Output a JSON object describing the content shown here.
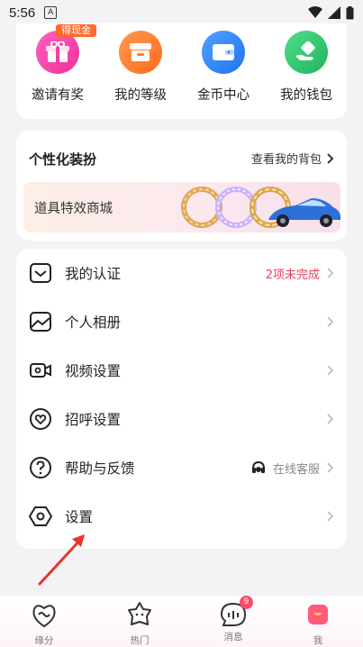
{
  "status_bar": {
    "time": "5:56",
    "notification_letter": "A"
  },
  "shortcuts": [
    {
      "label": "邀请有奖",
      "badge": "得现金",
      "icon": "gift-icon",
      "color": "#f23fa0"
    },
    {
      "label": "我的等级",
      "icon": "box-icon",
      "color": "#ff7a2b"
    },
    {
      "label": "金币中心",
      "icon": "wallet-icon",
      "color": "#2a84ff"
    },
    {
      "label": "我的钱包",
      "icon": "money-hand-icon",
      "color": "#2cc56b"
    }
  ],
  "personalization": {
    "title": "个性化装扮",
    "link": "查看我的背包",
    "banner_text": "道具特效商城"
  },
  "menu": [
    {
      "label": "我的认证",
      "right_text": "2项未完成",
      "icon": "shield-check-icon"
    },
    {
      "label": "个人相册",
      "right_text": "",
      "icon": "album-icon"
    },
    {
      "label": "视频设置",
      "right_text": "",
      "icon": "video-camera-icon"
    },
    {
      "label": "招呼设置",
      "right_text": "",
      "icon": "greeting-heart-icon"
    },
    {
      "label": "帮助与反馈",
      "right_text": "在线客服",
      "icon": "help-icon"
    },
    {
      "label": "设置",
      "right_text": "",
      "icon": "settings-hexagon-icon"
    }
  ],
  "bottom_nav": [
    {
      "label": "缘分",
      "icon": "fate-icon"
    },
    {
      "label": "热门",
      "icon": "hot-icon"
    },
    {
      "label": "消息",
      "icon": "message-icon",
      "badge": "9"
    },
    {
      "label": "我",
      "icon": "me-icon",
      "active": true
    }
  ],
  "colors": {
    "accent_red": "#ee3d5c",
    "active_tab": "#ff5a7a"
  }
}
